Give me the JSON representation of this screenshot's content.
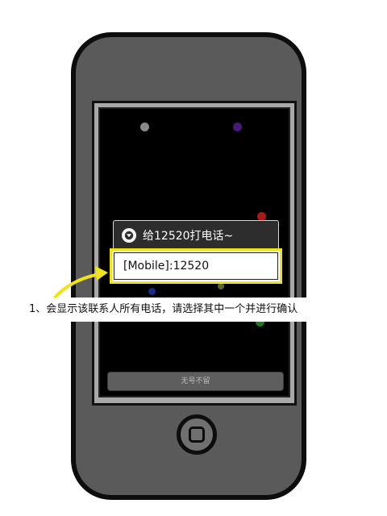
{
  "dialog": {
    "title": "给12520打电话~",
    "option": "[Mobile]:12520"
  },
  "bottom_bar": {
    "label": "无号不留"
  },
  "annotation": {
    "caption": "1、会显示该联系人所有电话，请选择其中一个并进行确认"
  },
  "colors": {
    "phone_body": "#5a5a5a",
    "screen": "#000000",
    "highlight": "#f1e31a",
    "dialog_header": "#2d2d2d"
  },
  "icons": [
    "dialog-menu-icon",
    "home-button",
    "yellow-arrow"
  ]
}
